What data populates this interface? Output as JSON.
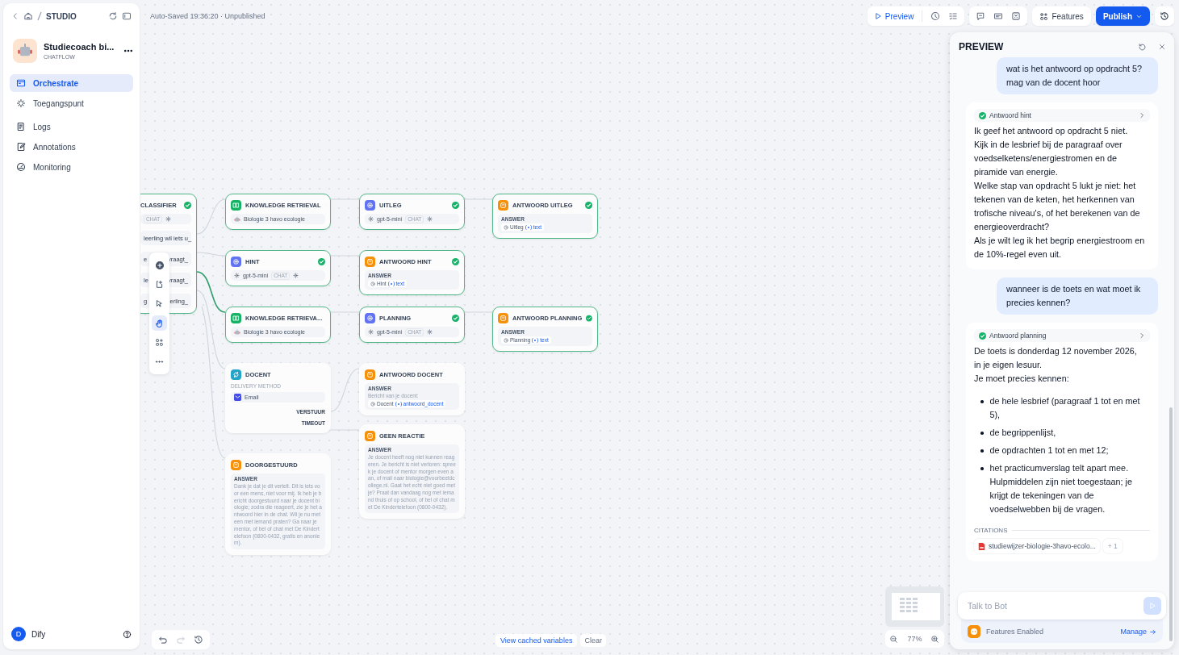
{
  "sidebar": {
    "breadcrumb": "STUDIO",
    "app": {
      "name": "Studiecoach bi...",
      "type": "CHATFLOW"
    },
    "nav": [
      {
        "label": "Orchestrate",
        "selected": true
      },
      {
        "label": "Toegangspunt",
        "selected": false
      },
      {
        "label": "Logs",
        "selected": false
      },
      {
        "label": "Annotations",
        "selected": false
      },
      {
        "label": "Monitoring",
        "selected": false
      }
    ],
    "user": {
      "initial": "D",
      "name": "Dify"
    }
  },
  "status": "Auto-Saved 19:36:20 · Unpublished",
  "toolbar": {
    "preview": "Preview",
    "features": "Features",
    "publish": "Publish"
  },
  "nodes": [
    {
      "kind": "classifier",
      "title": "CLASSIFIER",
      "ran": true,
      "tag": "CHAT",
      "classes": [
        {
          "left": "leerling wil iets u_"
        },
        {
          "left": "e",
          "right": "vraagt_"
        },
        {
          "left": "le",
          "right": "vraagt_"
        },
        {
          "left": "g",
          "right": "erling_"
        }
      ]
    },
    {
      "kind": "knowledge",
      "title": "KNOWLEDGE RETRIEVAL",
      "ran": true,
      "dataset": "Biologie 3 havo ecologie"
    },
    {
      "kind": "llm",
      "title": "UITLEG",
      "ran": true,
      "model": "gpt-5-mini",
      "tag": "CHAT"
    },
    {
      "kind": "answer",
      "title": "ANTWOORD UITLEG",
      "ran": true,
      "label": "ANSWER",
      "var_node": "Uitleg",
      "var": "text"
    },
    {
      "kind": "llm",
      "title": "HINT",
      "ran": true,
      "model": "gpt-5-mini",
      "tag": "CHAT"
    },
    {
      "kind": "answer",
      "title": "ANTWOORD HINT",
      "ran": true,
      "label": "ANSWER",
      "var_node": "Hint",
      "var": "text"
    },
    {
      "kind": "knowledge",
      "title": "KNOWLEDGE RETRIEVA...",
      "ran": true,
      "dataset": "Biologie 3 havo ecologie"
    },
    {
      "kind": "llm",
      "title": "PLANNING",
      "ran": true,
      "model": "gpt-5-mini",
      "tag": "CHAT"
    },
    {
      "kind": "answer",
      "title": "ANTWOORD PLANNING",
      "ran": true,
      "label": "ANSWER",
      "var_node": "Planning",
      "var": "text"
    },
    {
      "kind": "human",
      "title": "DOCENT",
      "ran": false,
      "method_label": "DELIVERY METHOD",
      "method": "Email",
      "outputs": [
        "VERSTUUR",
        "TIMEOUT"
      ]
    },
    {
      "kind": "answer",
      "title": "ANTWOORD DOCENT",
      "ran": false,
      "label": "ANSWER",
      "lead": "Bericht van je docent:",
      "var_node": "Docent",
      "var": "antwoord_docent"
    },
    {
      "kind": "answer",
      "title": "GEEN REACTIE",
      "ran": false,
      "label": "ANSWER",
      "body": "Je docent heeft nog niet kunnen reageren. Je bericht is niet verloren: spreek je docent of mentor morgen even aan, of mail naar biologie@voorbeeldcollege.nl. Gaat het echt niet goed met je? Praat dan vandaag nog met iemand thuis of op school, of bel of chat met De Kindertelefoon (0800-0432)."
    },
    {
      "kind": "answer",
      "title": "DOORGESTUURD",
      "ran": false,
      "label": "ANSWER",
      "body": "Dank je dat je dit vertelt. Dit is iets voor een mens, niet voor mij. Ik heb je bericht doorgestuurd naar je docent biologie; zodra die reageert, zie je het antwoord hier in de chat. Wil je nu meteen met iemand praten? Ga naar je mentor, of bel of chat met De Kindertelefoon (0800-0432, gratis en anoniem)."
    }
  ],
  "canvas_footer": {
    "cached": "View cached variables",
    "clear": "Clear",
    "zoom": "77%"
  },
  "preview": {
    "title": "PREVIEW",
    "messages": [
      {
        "kind": "user",
        "text": "wat is het antwoord op opdracht 5? mag van de docent hoor"
      },
      {
        "kind": "bot",
        "step": "Antwoord hint",
        "paragraphs": [
          "Ik geef het antwoord op opdracht 5 niet.\nKijk in de lesbrief bij de paragraaf over voedselketens/energiestromen en de piramide van energie.\nWelke stap van opdracht 5 lukt je niet: het tekenen van de keten, het herkennen van trofische niveau's, of het berekenen van de energieoverdracht?\nAls je wilt leg ik het begrip energiestroom en de 10%-regel even uit."
        ]
      },
      {
        "kind": "user",
        "text": "wanneer is de toets en wat moet ik precies kennen?"
      },
      {
        "kind": "bot",
        "step": "Antwoord planning",
        "paragraphs": [
          "De toets is donderdag 12 november 2026,\nin je eigen lesuur.\nJe moet precies kennen:"
        ],
        "list": [
          "de hele lesbrief (paragraaf 1 tot en met 5),",
          "de begrippenlijst,",
          "de opdrachten 1 tot en met 12;",
          "het practicumverslag telt apart mee.\nHulpmiddelen zijn niet toegestaan; je krijgt de tekeningen van de voedselwebben bij de vragen."
        ],
        "citations": {
          "label": "CITATIONS",
          "file": "studiewijzer-biologie-3havo-ecolo...",
          "more": "+ 1"
        }
      }
    ],
    "input": {
      "placeholder": "Talk to Bot"
    },
    "features": "Features Enabled",
    "manage": "Manage"
  }
}
